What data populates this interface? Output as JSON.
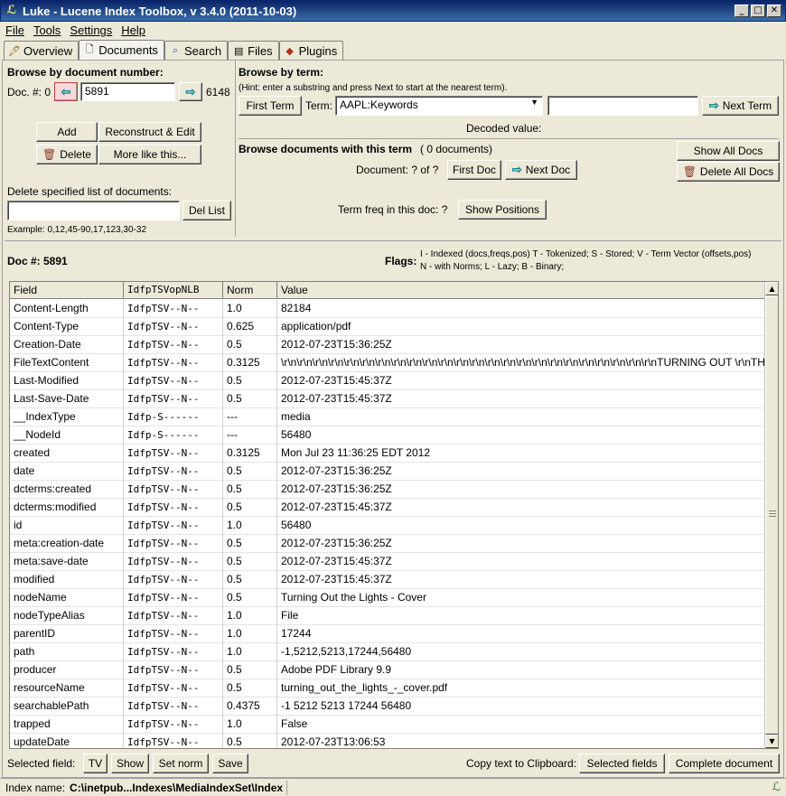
{
  "window": {
    "title": "Luke - Lucene Index Toolbox, v 3.4.0 (2011-10-03)",
    "minimize": "_",
    "maximize": "□",
    "close": "✕"
  },
  "menu": [
    "File",
    "Tools",
    "Settings",
    "Help"
  ],
  "tabs": [
    {
      "label": "Overview",
      "icon": "overview-icon"
    },
    {
      "label": "Documents",
      "icon": "documents-icon"
    },
    {
      "label": "Search",
      "icon": "search-icon"
    },
    {
      "label": "Files",
      "icon": "files-icon"
    },
    {
      "label": "Plugins",
      "icon": "plugins-icon"
    }
  ],
  "browse_by_number": {
    "heading": "Browse by document number:",
    "doc_label": "Doc. #: 0",
    "doc_value": "5891",
    "max": "6148",
    "add": "Add",
    "reconstruct": "Reconstruct & Edit",
    "delete": "Delete",
    "more_like": "More like this...",
    "delete_list_label": "Delete specified list of documents:",
    "delete_list_value": "",
    "del_list_btn": "Del List",
    "example": "Example: 0,12,45-90,17,123,30-32"
  },
  "browse_by_term": {
    "heading": "Browse by term:",
    "hint": "(Hint: enter a substring and press Next to start at the nearest term).",
    "first_term": "First Term",
    "term_label": "Term:",
    "term_field": "AAPL:Keywords",
    "term_value": "",
    "next_term": "Next Term",
    "decoded": "Decoded value:",
    "docs_heading": "Browse documents with this term",
    "docs_count": "( 0 documents)",
    "show_all": "Show All Docs",
    "delete_all": "Delete All Docs",
    "document_label": "Document: ?  of  ?",
    "first_doc": "First Doc",
    "next_doc": "Next Doc",
    "term_freq": "Term freq in this doc: ?",
    "show_positions": "Show Positions"
  },
  "doc": {
    "label": "Doc #: 5891",
    "flags_label": "Flags:",
    "flags_line1": "I - Indexed (docs,freqs,pos)    T - Tokenized;   S - Stored;   V - Term Vector (offsets,pos)",
    "flags_line2": "N - with Norms;   L - Lazy;       B - Binary;"
  },
  "table": {
    "headers": [
      "Field",
      "IdfpTSVopNLB",
      "Norm",
      "Value"
    ],
    "rows": [
      [
        "Content-Length",
        "IdfpTSV--N--",
        "1.0",
        "82184"
      ],
      [
        "Content-Type",
        "IdfpTSV--N--",
        "0.625",
        "application/pdf"
      ],
      [
        "Creation-Date",
        "IdfpTSV--N--",
        "0.5",
        "2012-07-23T15:36:25Z"
      ],
      [
        "FileTextContent",
        "IdfpTSV--N--",
        "0.3125",
        "\\r\\n\\r\\n\\r\\n\\r\\n\\r\\n\\r\\n\\r\\n\\r\\n\\r\\n\\r\\n\\r\\n\\r\\n\\r\\n\\r\\n\\r\\n\\r\\n\\r\\n\\r\\n\\r\\n\\r\\n\\r\\n\\r\\n\\r\\n\\r\\nTURNING OUT \\r\\nTHE LIGHT"
      ],
      [
        "Last-Modified",
        "IdfpTSV--N--",
        "0.5",
        "2012-07-23T15:45:37Z"
      ],
      [
        "Last-Save-Date",
        "IdfpTSV--N--",
        "0.5",
        "2012-07-23T15:45:37Z"
      ],
      [
        "__IndexType",
        "Idfp-S------",
        "---",
        "media"
      ],
      [
        "__NodeId",
        "Idfp-S------",
        "---",
        "56480"
      ],
      [
        "created",
        "IdfpTSV--N--",
        "0.3125",
        "Mon Jul 23 11:36:25 EDT 2012"
      ],
      [
        "date",
        "IdfpTSV--N--",
        "0.5",
        "2012-07-23T15:36:25Z"
      ],
      [
        "dcterms:created",
        "IdfpTSV--N--",
        "0.5",
        "2012-07-23T15:36:25Z"
      ],
      [
        "dcterms:modified",
        "IdfpTSV--N--",
        "0.5",
        "2012-07-23T15:45:37Z"
      ],
      [
        "id",
        "IdfpTSV--N--",
        "1.0",
        "56480"
      ],
      [
        "meta:creation-date",
        "IdfpTSV--N--",
        "0.5",
        "2012-07-23T15:36:25Z"
      ],
      [
        "meta:save-date",
        "IdfpTSV--N--",
        "0.5",
        "2012-07-23T15:45:37Z"
      ],
      [
        "modified",
        "IdfpTSV--N--",
        "0.5",
        "2012-07-23T15:45:37Z"
      ],
      [
        "nodeName",
        "IdfpTSV--N--",
        "0.5",
        "Turning Out the Lights - Cover"
      ],
      [
        "nodeTypeAlias",
        "IdfpTSV--N--",
        "1.0",
        "File"
      ],
      [
        "parentID",
        "IdfpTSV--N--",
        "1.0",
        "17244"
      ],
      [
        "path",
        "IdfpTSV--N--",
        "1.0",
        "-1,5212,5213,17244,56480"
      ],
      [
        "producer",
        "IdfpTSV--N--",
        "0.5",
        "Adobe PDF Library 9.9"
      ],
      [
        "resourceName",
        "IdfpTSV--N--",
        "0.5",
        "turning_out_the_lights_-_cover.pdf"
      ],
      [
        "searchablePath",
        "IdfpTSV--N--",
        "0.4375",
        "-1 5212 5213 17244 56480"
      ],
      [
        "trapped",
        "IdfpTSV--N--",
        "1.0",
        "False"
      ],
      [
        "updateDate",
        "IdfpTSV--N--",
        "0.5",
        "2012-07-23T13:06:53"
      ]
    ]
  },
  "bottom": {
    "selected_field": "Selected field:",
    "tv": "TV",
    "show": "Show",
    "set_norm": "Set norm",
    "save": "Save",
    "copy_label": "Copy text to Clipboard:",
    "selected_fields": "Selected fields",
    "complete_document": "Complete document"
  },
  "status": {
    "label": "Index name:",
    "value": "C:\\inetpub...Indexes\\MediaIndexSet\\Index"
  }
}
